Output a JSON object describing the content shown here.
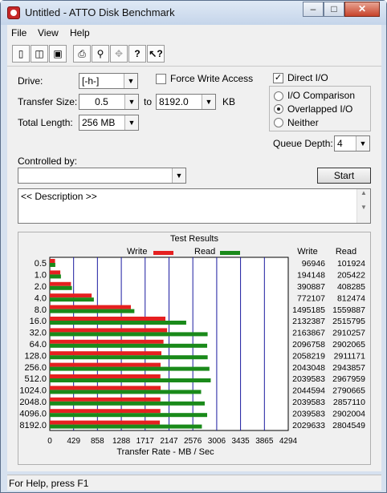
{
  "window": {
    "title": "Untitled - ATTO Disk Benchmark",
    "minimize": "–",
    "maximize": "□",
    "close": "✕"
  },
  "menu": [
    {
      "label": "File"
    },
    {
      "label": "View"
    },
    {
      "label": "Help"
    }
  ],
  "toolbar": [
    {
      "name": "new-document-icon",
      "glyph": "🗋"
    },
    {
      "name": "open-folder-icon",
      "glyph": "📂"
    },
    {
      "name": "save-icon",
      "glyph": "💾"
    },
    {
      "name": "print-icon",
      "glyph": "🖨"
    },
    {
      "name": "print-preview-icon",
      "glyph": "🔍"
    },
    {
      "name": "move-icon",
      "glyph": "✥"
    },
    {
      "name": "help-icon",
      "glyph": "?"
    },
    {
      "name": "context-help-icon",
      "glyph": "?"
    }
  ],
  "settings": {
    "drive_label": "Drive:",
    "drive_value": "[-h-]",
    "transfer_size_label": "Transfer Size:",
    "transfer_from": "0.5",
    "to_label": "to",
    "transfer_to": "8192.0",
    "kb_label": "KB",
    "total_length_label": "Total Length:",
    "total_length_value": "256 MB",
    "force_write_label": "Force Write Access",
    "force_write_checked": false,
    "direct_io_label": "Direct I/O",
    "direct_io_checked": true,
    "io_comparison_label": "I/O Comparison",
    "overlapped_io_label": "Overlapped I/O",
    "neither_label": "Neither",
    "selected_io_mode": "Overlapped I/O",
    "queue_depth_label": "Queue Depth:",
    "queue_depth_value": "4",
    "controlled_by_label": "Controlled by:",
    "controlled_by_value": "",
    "start_label": "Start",
    "description_text": "<< Description >>"
  },
  "chart_data": {
    "type": "bar",
    "title": "Test Results",
    "xlabel": "Transfer Rate - MB / Sec",
    "xlim": [
      0,
      4294
    ],
    "x_ticks": [
      "0",
      "429",
      "858",
      "1288",
      "1717",
      "2147",
      "2576",
      "3006",
      "3435",
      "3865",
      "4294"
    ],
    "categories": [
      "0.5",
      "1.0",
      "2.0",
      "4.0",
      "8.0",
      "16.0",
      "32.0",
      "64.0",
      "128.0",
      "256.0",
      "512.0",
      "1024.0",
      "2048.0",
      "4096.0",
      "8192.0"
    ],
    "series": [
      {
        "name": "Write",
        "color": "#e52020",
        "values": [
          96946,
          194148,
          390887,
          772107,
          1495185,
          2132387,
          2163867,
          2096758,
          2058219,
          2043048,
          2039583,
          2044594,
          2039583,
          2039583,
          2029633
        ]
      },
      {
        "name": "Read",
        "color": "#1a8a1a",
        "values": [
          101924,
          205422,
          408285,
          812474,
          1559887,
          2515795,
          2910257,
          2902065,
          2911171,
          2943857,
          2967959,
          2790665,
          2857110,
          2902004,
          2804549
        ]
      }
    ],
    "table_headers": [
      "Write",
      "Read"
    ],
    "legend": "top",
    "grid": true
  },
  "status": {
    "text": "For Help, press F1"
  }
}
